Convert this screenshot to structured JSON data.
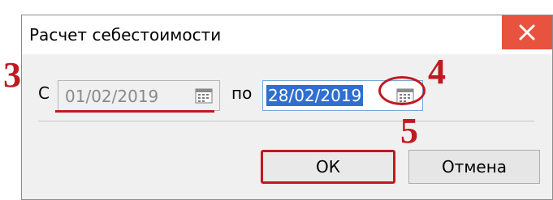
{
  "dialog": {
    "title": "Расчет себестоимости",
    "close_icon": "close-icon"
  },
  "period": {
    "from_label": "С",
    "from_value": "01/02/2019",
    "to_label": "по",
    "to_value": "28/02/2019",
    "calendar_icon": "calendar-icon"
  },
  "buttons": {
    "ok": "ОК",
    "cancel": "Отмена"
  },
  "annotations": {
    "step3": "3",
    "step4": "4",
    "step5": "5"
  },
  "colors": {
    "close_bg": "#e8533f",
    "annotation": "#c0191f",
    "selection": "#2f6fd0"
  }
}
